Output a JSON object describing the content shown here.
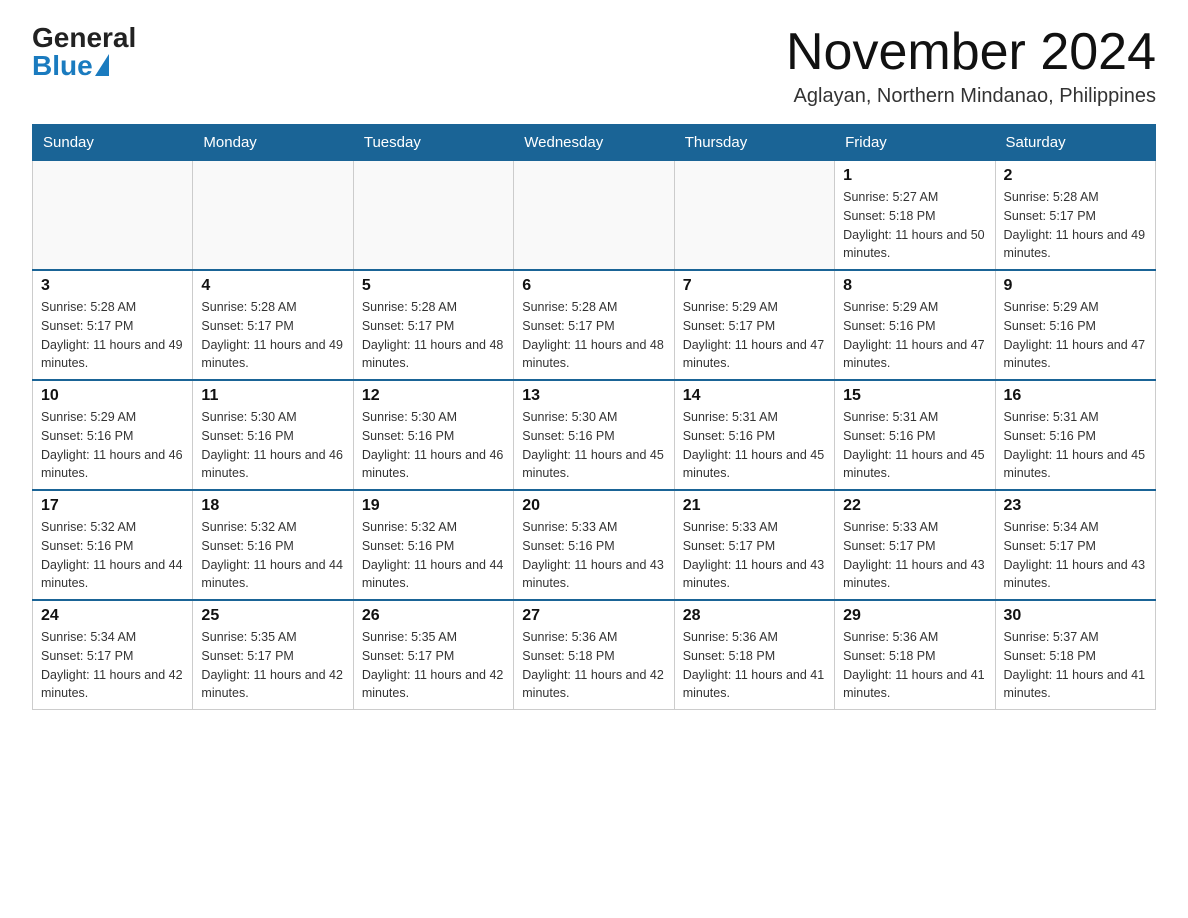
{
  "header": {
    "logo_general": "General",
    "logo_blue": "Blue",
    "month_title": "November 2024",
    "location": "Aglayan, Northern Mindanao, Philippines"
  },
  "weekdays": [
    "Sunday",
    "Monday",
    "Tuesday",
    "Wednesday",
    "Thursday",
    "Friday",
    "Saturday"
  ],
  "weeks": [
    [
      {
        "day": "",
        "sunrise": "",
        "sunset": "",
        "daylight": ""
      },
      {
        "day": "",
        "sunrise": "",
        "sunset": "",
        "daylight": ""
      },
      {
        "day": "",
        "sunrise": "",
        "sunset": "",
        "daylight": ""
      },
      {
        "day": "",
        "sunrise": "",
        "sunset": "",
        "daylight": ""
      },
      {
        "day": "",
        "sunrise": "",
        "sunset": "",
        "daylight": ""
      },
      {
        "day": "1",
        "sunrise": "Sunrise: 5:27 AM",
        "sunset": "Sunset: 5:18 PM",
        "daylight": "Daylight: 11 hours and 50 minutes."
      },
      {
        "day": "2",
        "sunrise": "Sunrise: 5:28 AM",
        "sunset": "Sunset: 5:17 PM",
        "daylight": "Daylight: 11 hours and 49 minutes."
      }
    ],
    [
      {
        "day": "3",
        "sunrise": "Sunrise: 5:28 AM",
        "sunset": "Sunset: 5:17 PM",
        "daylight": "Daylight: 11 hours and 49 minutes."
      },
      {
        "day": "4",
        "sunrise": "Sunrise: 5:28 AM",
        "sunset": "Sunset: 5:17 PM",
        "daylight": "Daylight: 11 hours and 49 minutes."
      },
      {
        "day": "5",
        "sunrise": "Sunrise: 5:28 AM",
        "sunset": "Sunset: 5:17 PM",
        "daylight": "Daylight: 11 hours and 48 minutes."
      },
      {
        "day": "6",
        "sunrise": "Sunrise: 5:28 AM",
        "sunset": "Sunset: 5:17 PM",
        "daylight": "Daylight: 11 hours and 48 minutes."
      },
      {
        "day": "7",
        "sunrise": "Sunrise: 5:29 AM",
        "sunset": "Sunset: 5:17 PM",
        "daylight": "Daylight: 11 hours and 47 minutes."
      },
      {
        "day": "8",
        "sunrise": "Sunrise: 5:29 AM",
        "sunset": "Sunset: 5:16 PM",
        "daylight": "Daylight: 11 hours and 47 minutes."
      },
      {
        "day": "9",
        "sunrise": "Sunrise: 5:29 AM",
        "sunset": "Sunset: 5:16 PM",
        "daylight": "Daylight: 11 hours and 47 minutes."
      }
    ],
    [
      {
        "day": "10",
        "sunrise": "Sunrise: 5:29 AM",
        "sunset": "Sunset: 5:16 PM",
        "daylight": "Daylight: 11 hours and 46 minutes."
      },
      {
        "day": "11",
        "sunrise": "Sunrise: 5:30 AM",
        "sunset": "Sunset: 5:16 PM",
        "daylight": "Daylight: 11 hours and 46 minutes."
      },
      {
        "day": "12",
        "sunrise": "Sunrise: 5:30 AM",
        "sunset": "Sunset: 5:16 PM",
        "daylight": "Daylight: 11 hours and 46 minutes."
      },
      {
        "day": "13",
        "sunrise": "Sunrise: 5:30 AM",
        "sunset": "Sunset: 5:16 PM",
        "daylight": "Daylight: 11 hours and 45 minutes."
      },
      {
        "day": "14",
        "sunrise": "Sunrise: 5:31 AM",
        "sunset": "Sunset: 5:16 PM",
        "daylight": "Daylight: 11 hours and 45 minutes."
      },
      {
        "day": "15",
        "sunrise": "Sunrise: 5:31 AM",
        "sunset": "Sunset: 5:16 PM",
        "daylight": "Daylight: 11 hours and 45 minutes."
      },
      {
        "day": "16",
        "sunrise": "Sunrise: 5:31 AM",
        "sunset": "Sunset: 5:16 PM",
        "daylight": "Daylight: 11 hours and 45 minutes."
      }
    ],
    [
      {
        "day": "17",
        "sunrise": "Sunrise: 5:32 AM",
        "sunset": "Sunset: 5:16 PM",
        "daylight": "Daylight: 11 hours and 44 minutes."
      },
      {
        "day": "18",
        "sunrise": "Sunrise: 5:32 AM",
        "sunset": "Sunset: 5:16 PM",
        "daylight": "Daylight: 11 hours and 44 minutes."
      },
      {
        "day": "19",
        "sunrise": "Sunrise: 5:32 AM",
        "sunset": "Sunset: 5:16 PM",
        "daylight": "Daylight: 11 hours and 44 minutes."
      },
      {
        "day": "20",
        "sunrise": "Sunrise: 5:33 AM",
        "sunset": "Sunset: 5:16 PM",
        "daylight": "Daylight: 11 hours and 43 minutes."
      },
      {
        "day": "21",
        "sunrise": "Sunrise: 5:33 AM",
        "sunset": "Sunset: 5:17 PM",
        "daylight": "Daylight: 11 hours and 43 minutes."
      },
      {
        "day": "22",
        "sunrise": "Sunrise: 5:33 AM",
        "sunset": "Sunset: 5:17 PM",
        "daylight": "Daylight: 11 hours and 43 minutes."
      },
      {
        "day": "23",
        "sunrise": "Sunrise: 5:34 AM",
        "sunset": "Sunset: 5:17 PM",
        "daylight": "Daylight: 11 hours and 43 minutes."
      }
    ],
    [
      {
        "day": "24",
        "sunrise": "Sunrise: 5:34 AM",
        "sunset": "Sunset: 5:17 PM",
        "daylight": "Daylight: 11 hours and 42 minutes."
      },
      {
        "day": "25",
        "sunrise": "Sunrise: 5:35 AM",
        "sunset": "Sunset: 5:17 PM",
        "daylight": "Daylight: 11 hours and 42 minutes."
      },
      {
        "day": "26",
        "sunrise": "Sunrise: 5:35 AM",
        "sunset": "Sunset: 5:17 PM",
        "daylight": "Daylight: 11 hours and 42 minutes."
      },
      {
        "day": "27",
        "sunrise": "Sunrise: 5:36 AM",
        "sunset": "Sunset: 5:18 PM",
        "daylight": "Daylight: 11 hours and 42 minutes."
      },
      {
        "day": "28",
        "sunrise": "Sunrise: 5:36 AM",
        "sunset": "Sunset: 5:18 PM",
        "daylight": "Daylight: 11 hours and 41 minutes."
      },
      {
        "day": "29",
        "sunrise": "Sunrise: 5:36 AM",
        "sunset": "Sunset: 5:18 PM",
        "daylight": "Daylight: 11 hours and 41 minutes."
      },
      {
        "day": "30",
        "sunrise": "Sunrise: 5:37 AM",
        "sunset": "Sunset: 5:18 PM",
        "daylight": "Daylight: 11 hours and 41 minutes."
      }
    ]
  ]
}
